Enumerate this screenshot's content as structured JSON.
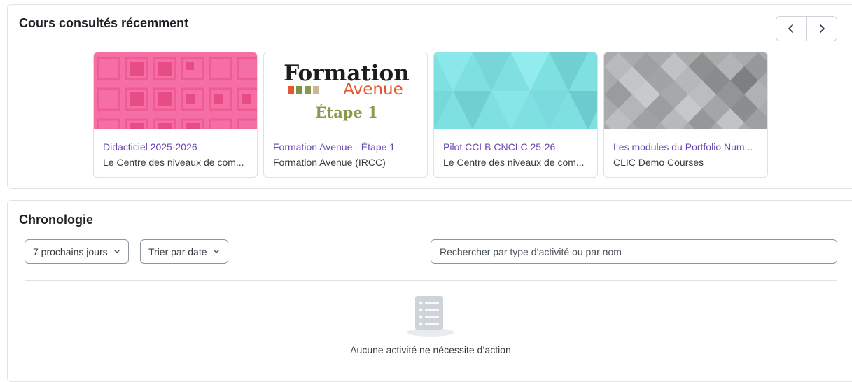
{
  "recent": {
    "title": "Cours consultés récemment",
    "prev_icon": "chevron-left-icon",
    "next_icon": "chevron-right-icon",
    "courses": [
      {
        "title": "Didacticiel 2025-2026",
        "subtitle": "Le Centre des niveaux de com...",
        "image": "pink-squares-pattern"
      },
      {
        "title": "Formation Avenue - Étape 1",
        "subtitle": "Formation Avenue (IRCC)",
        "image": "formation-avenue-logo",
        "logo": {
          "line1": "Formation",
          "line2": "Avenue",
          "line3": "Étape 1"
        }
      },
      {
        "title": "Pilot CCLB CNCLC 25-26",
        "subtitle": "Le Centre des niveaux de com...",
        "image": "teal-triangles-pattern"
      },
      {
        "title": "Les modules du Portfolio Num...",
        "subtitle": "CLIC Demo Courses",
        "image": "grey-diamonds-pattern"
      }
    ]
  },
  "timeline": {
    "title": "Chronologie",
    "filter_label": "7 prochains jours",
    "sort_label": "Trier par date",
    "search_placeholder": "Rechercher par type d’activité ou par nom",
    "empty_icon": "list-document-icon",
    "empty_text": "Aucune activité ne nécessite d’action"
  },
  "colors": {
    "link": "#6a48b1",
    "border": "#dee2e6",
    "pink": "#f56fa4",
    "teal": "#7fe0e2",
    "grey": "#a9aaab",
    "logo_orange": "#e8552c",
    "logo_olive": "#8a9a4a"
  }
}
